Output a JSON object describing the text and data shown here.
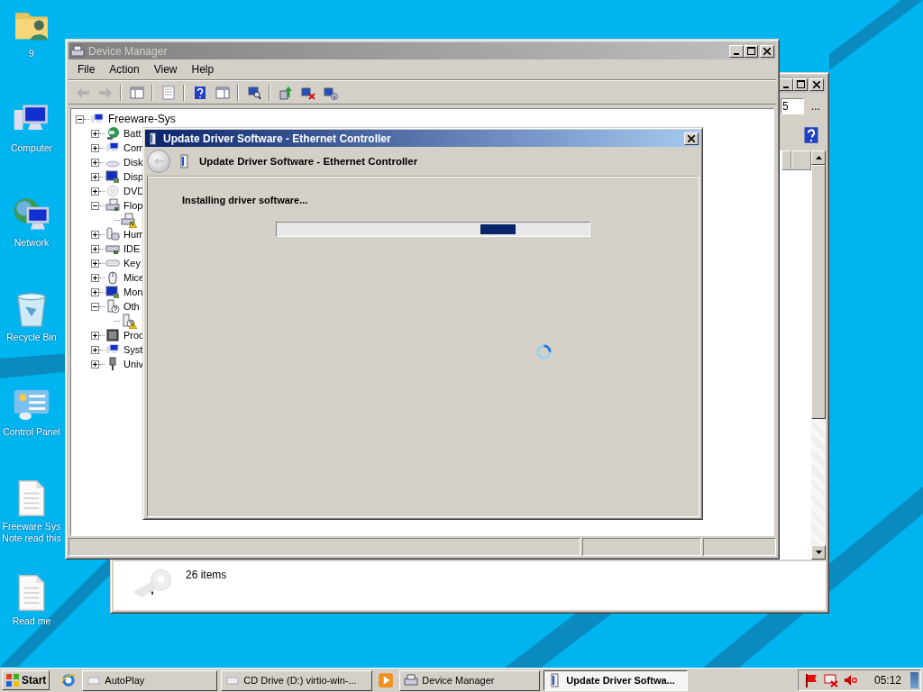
{
  "desktop_icons": [
    {
      "label": "9",
      "kind": "user-folder"
    },
    {
      "label": "Computer",
      "kind": "computer"
    },
    {
      "label": "Network",
      "kind": "network"
    },
    {
      "label": "Recycle Bin",
      "kind": "recycle-bin"
    },
    {
      "label": "Control Panel",
      "kind": "control-panel"
    },
    {
      "label": "Freeware Sys Note read this",
      "kind": "document"
    },
    {
      "label": "Read me",
      "kind": "document"
    }
  ],
  "background_window": {
    "path_field": "5",
    "browse_button": "...",
    "status": "26 items"
  },
  "device_manager": {
    "title": "Device Manager",
    "menu": [
      "File",
      "Action",
      "View",
      "Help"
    ],
    "toolbar": [
      {
        "kind": "back",
        "disabled": true
      },
      {
        "kind": "forward",
        "disabled": true
      },
      {
        "kind": "console-tree",
        "disabled": false
      },
      {
        "kind": "properties",
        "disabled": false
      },
      {
        "kind": "help",
        "disabled": false
      },
      {
        "kind": "action-pane",
        "disabled": false
      },
      {
        "kind": "scan",
        "disabled": false
      },
      {
        "kind": "update-driver",
        "disabled": false
      },
      {
        "kind": "uninstall",
        "disabled": false
      },
      {
        "kind": "disable",
        "disabled": false
      }
    ],
    "tree": {
      "label": "Freeware-Sys",
      "kind": "computer",
      "expanded": true,
      "children": [
        {
          "label": "Batt",
          "kind": "battery",
          "expanded": false
        },
        {
          "label": "Com",
          "kind": "computer",
          "expanded": false
        },
        {
          "label": "Disk",
          "kind": "disk",
          "expanded": false
        },
        {
          "label": "Disp",
          "kind": "display",
          "expanded": false
        },
        {
          "label": "DVD",
          "kind": "dvd",
          "expanded": false
        },
        {
          "label": "Flop",
          "kind": "floppy",
          "expanded": true,
          "children": [
            {
              "kind": "floppy",
              "warning": true
            }
          ]
        },
        {
          "label": "Hum",
          "kind": "hid",
          "expanded": false
        },
        {
          "label": "IDE",
          "kind": "ide",
          "expanded": false
        },
        {
          "label": "Key",
          "kind": "keyboard",
          "expanded": false
        },
        {
          "label": "Mice",
          "kind": "mouse",
          "expanded": false
        },
        {
          "label": "Mon",
          "kind": "display",
          "expanded": false
        },
        {
          "label": "Oth",
          "kind": "other",
          "expanded": true,
          "children": [
            {
              "kind": "other",
              "warning": true
            }
          ]
        },
        {
          "label": "Proc",
          "kind": "processor",
          "expanded": false
        },
        {
          "label": "Syst",
          "kind": "computer",
          "expanded": false
        },
        {
          "label": "Univ",
          "kind": "usb",
          "expanded": false
        }
      ]
    }
  },
  "dialog": {
    "title": "Update Driver Software - Ethernet Controller",
    "header": "Update Driver Software - Ethernet Controller",
    "message": "Installing driver software...",
    "progress": {
      "indeterminate": true
    },
    "busy": true
  },
  "taskbar": {
    "start": "Start",
    "items": [
      {
        "kind": "launcher",
        "selected": false
      },
      {
        "kind": "window",
        "label": "AutoPlay",
        "selected": false
      },
      {
        "kind": "window",
        "label": "CD Drive (D:) virtio-win-...",
        "selected": false
      },
      {
        "kind": "launcher",
        "selected": false
      },
      {
        "kind": "window",
        "label": "Device Manager",
        "selected": false
      },
      {
        "kind": "window",
        "label": "Update Driver Softwa...",
        "selected": true
      }
    ],
    "tray": [
      {
        "kind": "flag"
      },
      {
        "kind": "network-error"
      },
      {
        "kind": "speaker-muted"
      }
    ],
    "clock": "05:12"
  }
}
